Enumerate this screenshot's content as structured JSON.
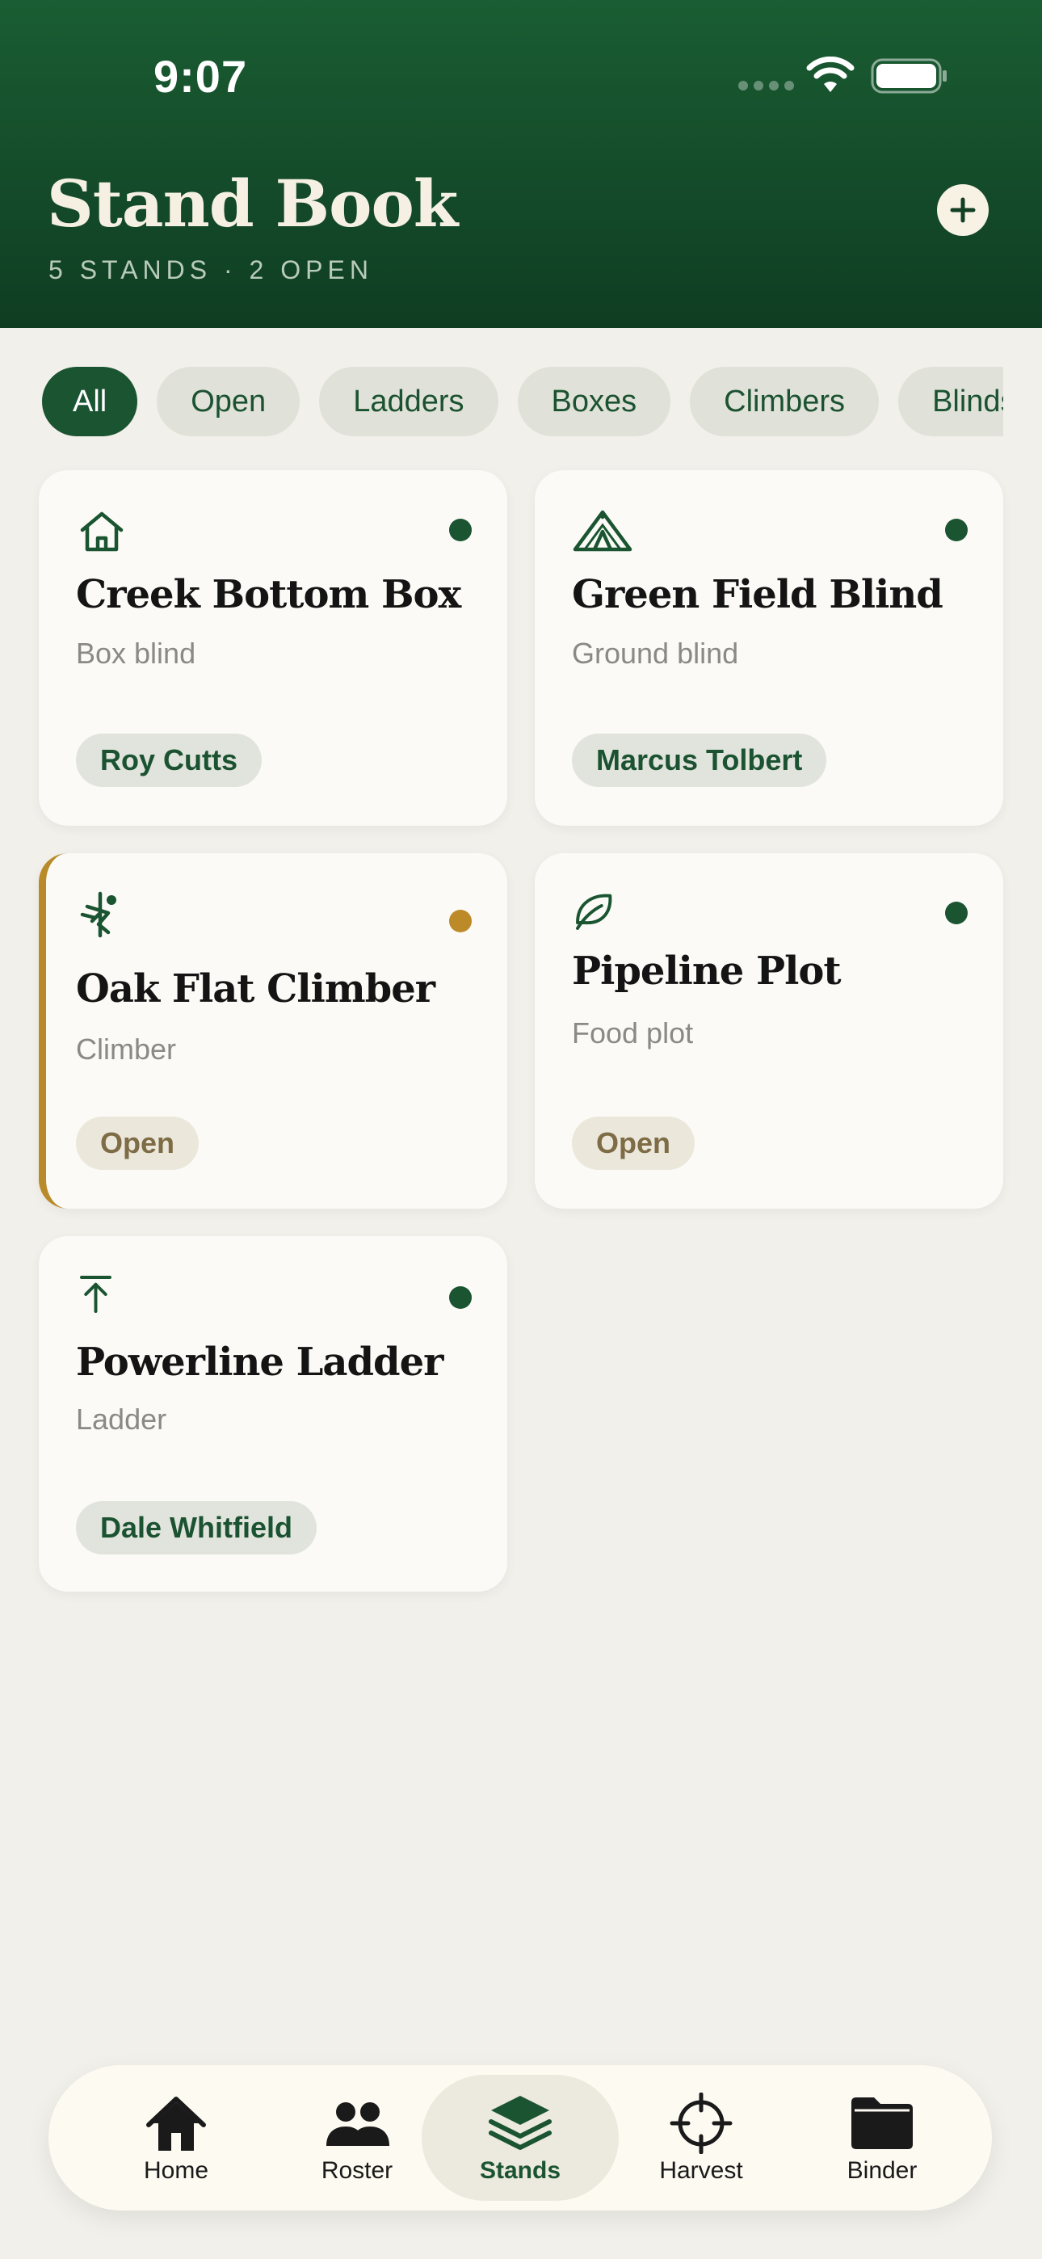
{
  "status_bar": {
    "time": "9:07"
  },
  "header": {
    "title": "Stand Book",
    "subtitle": "5 STANDS · 2 OPEN"
  },
  "filters": [
    "All",
    "Open",
    "Ladders",
    "Boxes",
    "Climbers",
    "Blinds"
  ],
  "stands": [
    {
      "name": "Creek Bottom Box",
      "type": "Box blind",
      "assignee": "Roy Cutts",
      "icon": "house-icon",
      "status_color": "#1a5431"
    },
    {
      "name": "Green Field Blind",
      "type": "Ground blind",
      "assignee": "Marcus Tolbert",
      "icon": "tent-icon",
      "status_color": "#1a5431"
    },
    {
      "name": "Oak Flat Climber",
      "type": "Climber",
      "assignee": "Open",
      "icon": "climber-icon",
      "status_color": "#bd8a2a"
    },
    {
      "name": "Pipeline Plot",
      "type": "Food plot",
      "assignee": "Open",
      "icon": "leaf-icon",
      "status_color": "#1a5431"
    },
    {
      "name": "Powerline Ladder",
      "type": "Ladder",
      "assignee": "Dale Whitfield",
      "icon": "ladder-icon",
      "status_color": "#1a5431"
    }
  ],
  "tabs": [
    {
      "label": "Home",
      "icon": "home-icon"
    },
    {
      "label": "Roster",
      "icon": "people-icon"
    },
    {
      "label": "Stands",
      "icon": "layers-icon",
      "active": true
    },
    {
      "label": "Harvest",
      "icon": "crosshair-icon"
    },
    {
      "label": "Binder",
      "icon": "folder-icon"
    }
  ],
  "colors": {
    "brand": "#1a5431",
    "accent": "#bd8a2a",
    "background": "#f2f0ea"
  }
}
